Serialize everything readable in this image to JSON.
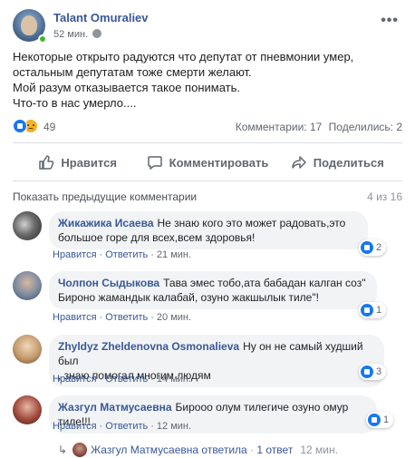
{
  "post": {
    "author": "Talant Omuraliev",
    "time": "52 мин.",
    "options_icon": "more-options-icon",
    "text_lines": [
      "Некоторые открыто радуются что депутат от пневмонии умер,",
      "остальным депутатам тоже смерти желают.",
      "Мой разум отказывается такое понимать.",
      "Что-то в нас умерло...."
    ],
    "reactions": {
      "icons": [
        "like",
        "sad"
      ],
      "count": "49"
    },
    "comments_stat": "Комментарии: 17",
    "shares_stat": "Поделились: 2"
  },
  "actions": {
    "like": "Нравится",
    "comment": "Комментировать",
    "share": "Поделиться"
  },
  "comments_bar": {
    "prev_label": "Показать предыдущие комментарии",
    "page_count": "4 из 16"
  },
  "comments": [
    {
      "name": "Жикажика Исаева",
      "text_lines": [
        "Не знаю кого это может радовать,это",
        "большое горе для всех,всем здоровья!"
      ],
      "like": "Нравится",
      "reply": "Ответить",
      "time": "21 мин.",
      "reaction_count": "2"
    },
    {
      "name": "Чолпон Сыдыкова",
      "text_lines": [
        "Тава эмес тобо,ата бабадан калган соз\"",
        "Бироно жамандык калабай, озуно жакшылык тиле\"!"
      ],
      "like": "Нравится",
      "reply": "Ответить",
      "time": "20 мин.",
      "reaction_count": "1"
    },
    {
      "name": "Zhyldyz Zheldenovna Osmonalieva",
      "text_lines": [
        "Ну он не самый худший был",
        ", знаю помогал многим людям"
      ],
      "like": "Нравится",
      "reply": "Ответить",
      "time": "14 мин.",
      "reaction_count": "3"
    },
    {
      "name": "Жазгул Матмусаевна",
      "text_lines": [
        "Бирооо олум тилегиче озуно омур тиле!!!"
      ],
      "like": "Нравится",
      "reply": "Ответить",
      "time": "12 мин.",
      "reaction_count": "1"
    }
  ],
  "reply_summary": {
    "author_replied": "Жазгул Матмусаевна ответила",
    "replies": "1 ответ",
    "time": "12 мин."
  },
  "colors": {
    "link_blue": "#385898",
    "like_blue": "#1877f2",
    "bubble_gray": "#f2f3f5",
    "muted": "#606770"
  }
}
